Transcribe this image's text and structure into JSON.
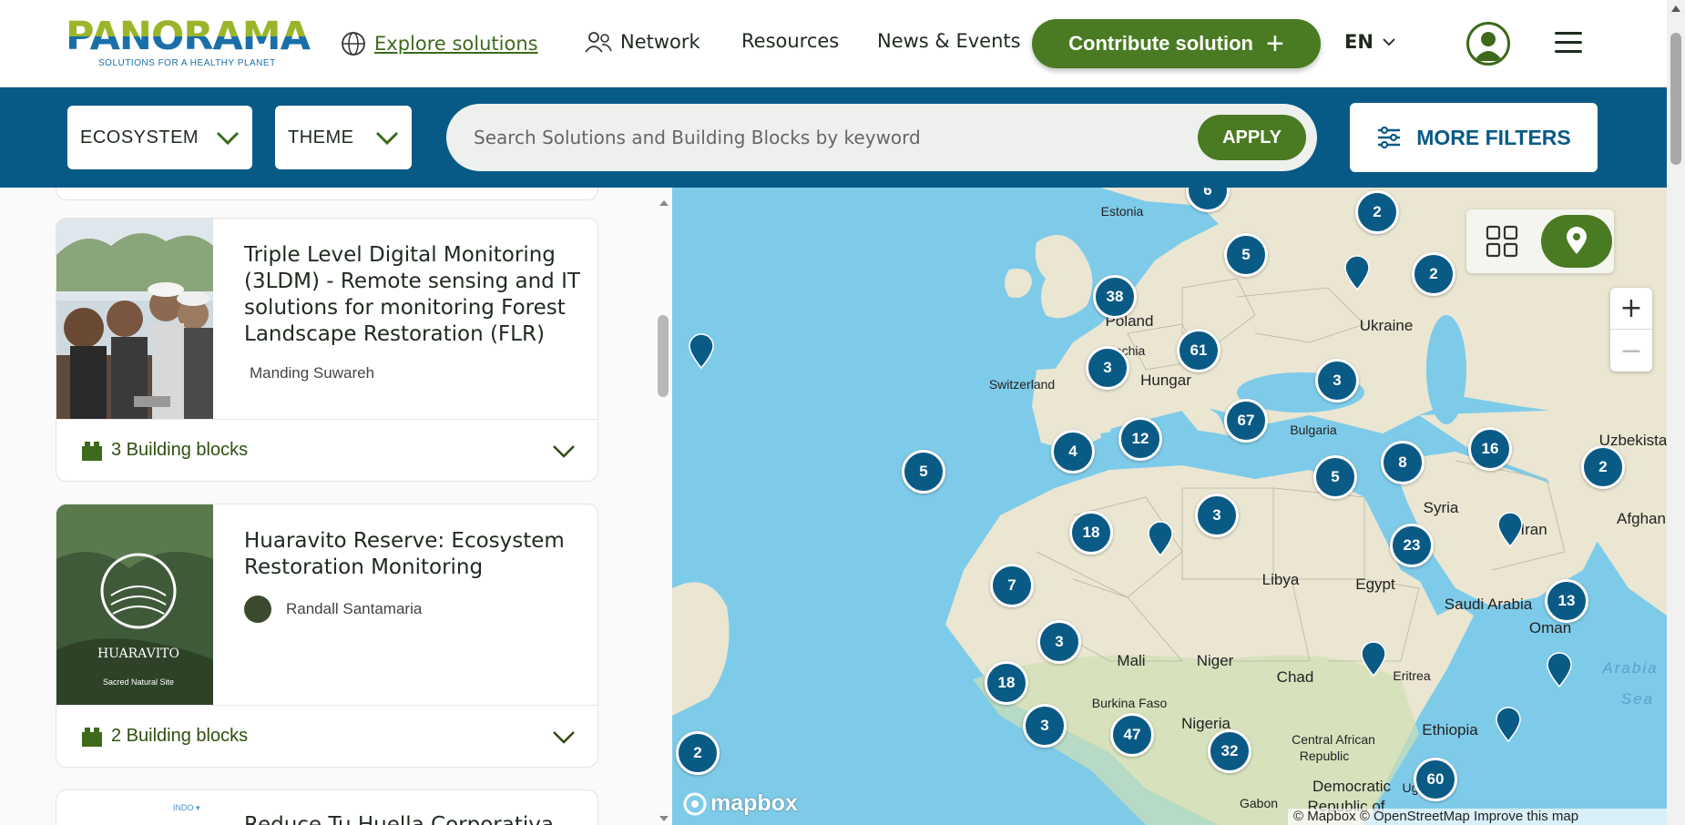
{
  "header": {
    "logo_word": "PANORAMA",
    "logo_tagline": "SOLUTIONS FOR A HEALTHY PLANET",
    "nav": {
      "explore": "Explore solutions",
      "network": "Network",
      "resources": "Resources",
      "news": "News & Events"
    },
    "contribute_label": "Contribute solution",
    "language": "EN"
  },
  "filters": {
    "ecosystem": "ECOSYSTEM",
    "theme": "THEME",
    "search_placeholder": "Search Solutions and Building Blocks by keyword",
    "apply": "APPLY",
    "more_filters": "MORE FILTERS"
  },
  "cards": [
    {
      "title": "Triple Level Digital Monitoring (3LDM) - Remote sensing and IT solutions for monitoring Forest Landscape Restoration (FLR)",
      "author": "Manding Suwareh",
      "building_blocks": "3 Building blocks"
    },
    {
      "title": "Huaravito Reserve: Ecosystem Restoration Monitoring",
      "author": "Randall Santamaria",
      "building_blocks": "2 Building blocks",
      "image_text": "HUARAVITO",
      "image_subtext": "Sacred Natural Site"
    },
    {
      "title": "Reduce Tu Huella Corporativa"
    }
  ],
  "map": {
    "clusters": [
      "6",
      "2",
      "5",
      "2",
      "38",
      "61",
      "3",
      "3",
      "67",
      "4",
      "12",
      "5",
      "5",
      "8",
      "16",
      "2",
      "3",
      "18",
      "23",
      "7",
      "13",
      "3",
      "18",
      "3",
      "47",
      "32",
      "2",
      "60"
    ],
    "labels": {
      "estonia": "Estonia",
      "poland": "Poland",
      "czechia": "Czechia",
      "ukraine": "Ukraine",
      "switzerland": "Switzerland",
      "hungary": "Hungar",
      "bulgaria": "Bulgaria",
      "uzbekistan": "Uzbekista",
      "syria": "Syria",
      "iran": "Iran",
      "afghanistan": "Afghan",
      "libya": "Libya",
      "egypt": "Egypt",
      "saudi": "Saudi Arabia",
      "oman": "Oman",
      "arabian": "Arabia",
      "sea": "Sea",
      "mali": "Mali",
      "niger": "Niger",
      "chad": "Chad",
      "eritrea": "Eritrea",
      "burkina": "Burkina Faso",
      "nigeria": "Nigeria",
      "ethiopia": "Ethiopia",
      "car": "Central African",
      "car2": "Republic",
      "drc": "Democratic",
      "drc2": "Republic of",
      "uganda": "Uganda",
      "gabon": "Gabon"
    },
    "mapbox": "mapbox",
    "attribution": "© Mapbox © OpenStreetMap Improve this map"
  }
}
